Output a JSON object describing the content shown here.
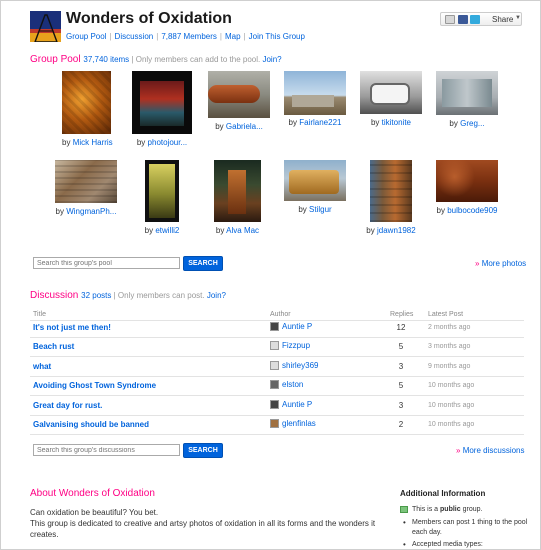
{
  "group": {
    "title": "Wonders of Oxidation",
    "nav": [
      "Group Pool",
      "Discussion",
      "7,887 Members",
      "Map",
      "Join This Group"
    ],
    "share_label": "Share"
  },
  "pool": {
    "heading": "Group Pool",
    "count": "37,740 items",
    "note": "Only members can add to the pool.",
    "join": "Join?",
    "by": "by",
    "row1": [
      "Mick Harris",
      "photojour...",
      "Gabriela...",
      "Fairlane221",
      "tikitonite",
      "Greg..."
    ],
    "row2": [
      "WingmanPh...",
      "etwilli2",
      "Alva Mac",
      "Stilgur",
      "jdawn1982",
      "bulbocode909"
    ],
    "search_placeholder": "Search this group's pool",
    "search_button": "SEARCH",
    "more": "More photos"
  },
  "discussion": {
    "heading": "Discussion",
    "count": "32 posts",
    "note": "Only members can post.",
    "join": "Join?",
    "columns": {
      "title": "Title",
      "author": "Author",
      "replies": "Replies",
      "latest": "Latest Post"
    },
    "rows": [
      {
        "title": "It's not just me then!",
        "author": "Auntie P",
        "replies": "12",
        "latest": "2 months ago"
      },
      {
        "title": "Beach rust",
        "author": "Fizzpup",
        "replies": "5",
        "latest": "3 months ago"
      },
      {
        "title": "what",
        "author": "shirley369",
        "replies": "3",
        "latest": "9 months ago"
      },
      {
        "title": "Avoiding Ghost Town Syndrome",
        "author": "elston",
        "replies": "5",
        "latest": "10 months ago"
      },
      {
        "title": "Great day for rust.",
        "author": "Auntie P",
        "replies": "3",
        "latest": "10 months ago"
      },
      {
        "title": "Galvanising should be banned",
        "author": "glenfinlas",
        "replies": "2",
        "latest": "10 months ago"
      }
    ],
    "search_placeholder": "Search this group's discussions",
    "search_button": "SEARCH",
    "more": "More discussions"
  },
  "about": {
    "heading": "About Wonders of Oxidation",
    "line1": "Can oxidation be beautiful? You bet.",
    "line2": "This group is dedicated to creative and artsy photos of oxidation in all its forms and the wonders it",
    "line3": "creates."
  },
  "info": {
    "heading": "Additional Information",
    "public_prefix": "This is a",
    "public_word": "public",
    "public_suffix": "group.",
    "members_line1": "Members can post 1 thing to the pool",
    "members_line2": "each day.",
    "media": "Accepted media types:"
  },
  "colors": {
    "accent_pink": "#ff0084",
    "link_blue": "#0063dc",
    "button_blue": "#0063dc"
  }
}
